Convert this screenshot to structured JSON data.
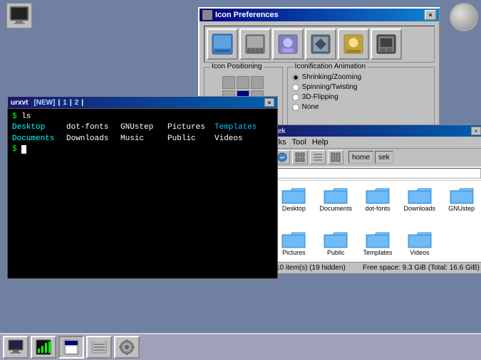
{
  "desktop": {
    "background_color": "#7080a0"
  },
  "icon_prefs_window": {
    "title": "Icon Preferences",
    "close_btn": "×",
    "sections": {
      "icon_positioning": "Icon Positioning",
      "iconification_animation": "Iconification Animation"
    },
    "animations": [
      {
        "label": "Shrinking/Zooming",
        "checked": true
      },
      {
        "label": "Spinning/Twisting",
        "checked": false
      },
      {
        "label": "3D-Flipping",
        "checked": false
      },
      {
        "label": "None",
        "checked": false
      }
    ]
  },
  "terminal_window": {
    "title": "urxvt",
    "tabs": [
      "[NEW]",
      "1",
      "2"
    ],
    "close_btn": "×",
    "lines": [
      {
        "type": "prompt",
        "text": "$ ls"
      },
      {
        "type": "output",
        "cols": [
          {
            "text": "Desktop",
            "color": "cyan"
          },
          {
            "text": "dot-fonts",
            "color": "white"
          },
          {
            "text": "GNUstep",
            "color": "white"
          },
          {
            "text": "Pictures",
            "color": "white"
          },
          {
            "text": "Templates",
            "color": "blue"
          }
        ]
      },
      {
        "type": "output",
        "cols": [
          {
            "text": "Documents",
            "color": "cyan"
          },
          {
            "text": "Downloads",
            "color": "white"
          },
          {
            "text": "Music",
            "color": "white"
          },
          {
            "text": "Public",
            "color": "white"
          },
          {
            "text": "Videos",
            "color": "white"
          }
        ]
      },
      {
        "type": "prompt_cursor",
        "text": "$ "
      }
    ]
  },
  "filemanager_window": {
    "title": "sek",
    "close_btn": "×",
    "menu": [
      "rks",
      "Tool",
      "Help"
    ],
    "toolbar": {
      "back_label": "←",
      "home_label": "home",
      "search_label": "sek"
    },
    "path": "/",
    "folders": [
      {
        "name": "Desktop"
      },
      {
        "name": "Documents"
      },
      {
        "name": "dot-fonts"
      },
      {
        "name": "Downloads"
      },
      {
        "name": "GNUstep"
      },
      {
        "name": "Pictures"
      },
      {
        "name": "Public"
      },
      {
        "name": "Templates"
      },
      {
        "name": "Videos"
      }
    ],
    "status_left": "10 item(s) (19 hidden)",
    "status_right": "Free space: 9.3 GiB (Total: 16.6 GiB)"
  },
  "taskbar": {
    "items": [
      {
        "label": "🖥",
        "name": "taskbar-item-desktop",
        "active": false
      },
      {
        "label": "📊",
        "name": "taskbar-item-monitor",
        "active": false
      },
      {
        "label": "🖼",
        "name": "taskbar-item-window",
        "active": true
      },
      {
        "label": "🗂",
        "name": "taskbar-item-files",
        "active": false
      },
      {
        "label": "⚙",
        "name": "taskbar-item-settings",
        "active": false
      }
    ]
  }
}
